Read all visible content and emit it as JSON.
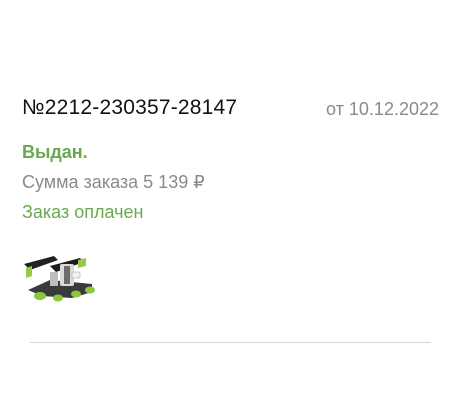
{
  "order": {
    "number": "№2212-230357-28147",
    "date": "от 10.12.2022",
    "status": "Выдан.",
    "sum_text": "Сумма заказа 5 139 ₽",
    "payment_status": "Заказ оплачен"
  },
  "product": {
    "icon": "stepper-machine-image"
  },
  "colors": {
    "status_green": "#6aa84f",
    "muted_gray": "#8a8a8a",
    "text_dark": "#111111"
  }
}
